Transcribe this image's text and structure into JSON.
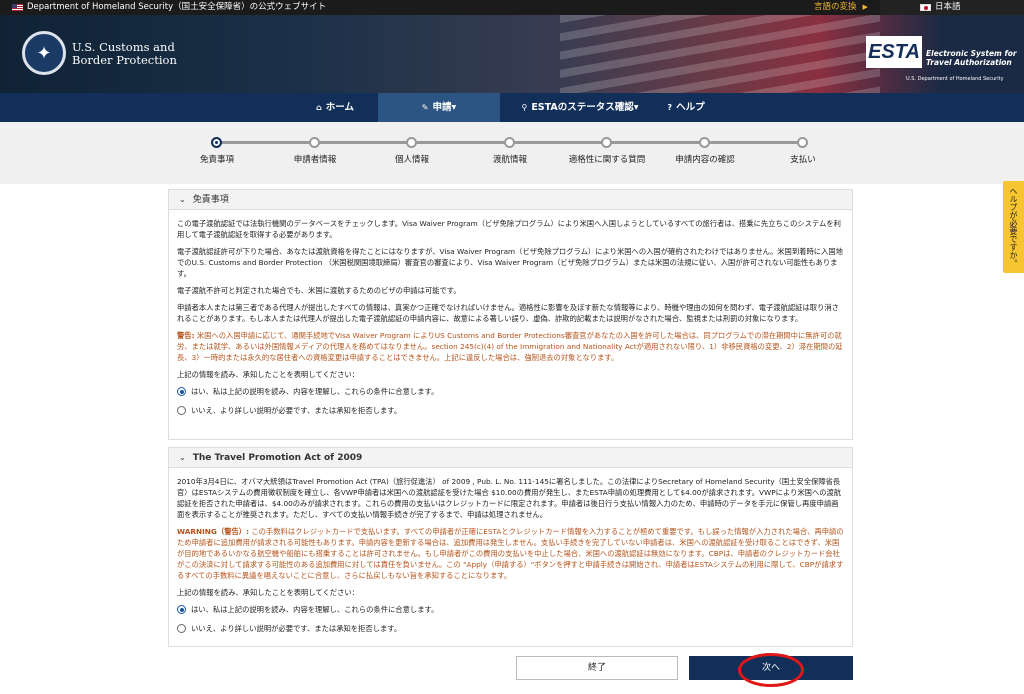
{
  "topbar": {
    "site_name": "Department of Homeland Security（国土安全保障省）の公式ウェブサイト",
    "language_change": "言語の変換",
    "language": "日本語"
  },
  "header": {
    "agency_line1": "U.S. Customs and",
    "agency_line2": "Border Protection",
    "esta_logo_text": "ESTA",
    "esta_tagline1": "Electronic System for",
    "esta_tagline2": "Travel Authorization",
    "esta_sub": "U.S. Department of Homeland Security"
  },
  "nav": {
    "home": "ホーム",
    "apply": "申請",
    "status": "ESTAのステータス確認",
    "help": "ヘルプ"
  },
  "steps": [
    {
      "label": "免責事項",
      "current": true
    },
    {
      "label": "申請者情報"
    },
    {
      "label": "個人情報"
    },
    {
      "label": "渡航情報"
    },
    {
      "label": "適格性に関する質問"
    },
    {
      "label": "申請内容の確認"
    },
    {
      "label": "支払い"
    }
  ],
  "disclaimer": {
    "title": "免責事項",
    "p1": "この電子渡航認証では法執行機関のデータベースをチェックします。Visa Waiver Program（ビザ免除プログラム）により米国へ入国しようとしているすべての旅行者は、搭乗に先立ちこのシステムを利用して電子渡航認証を取得する必要があります。",
    "p2": "電子渡航認証許可が下りた場合、あなたは渡航資格を得たことにはなりますが、Visa Waiver Program（ビザ免除プログラム）により米国への入国が確約されたわけではありません。米国到着時に入国地でのU.S. Customs and Border Protection （米国税関国境取締局）審査官の審査により、Visa Waiver Program（ビザ免除プログラム）または米国の法規に従い、入国が許可されない可能性もあります。",
    "p3": "電子渡航不許可と判定された場合でも、米国に渡航するためのビザの申請は可能です。",
    "p4": "申請者本人または第三者である代理人が提出したすべての情報は、真実かつ正確でなければいけません。適格性に影響を及ぼす新たな情報等により、時機や理由の如何を問わず、電子渡航認証は取り消されることがあります。もし本人または代理人が提出した電子渡航認証の申請内容に、故意による著しい誤り、虚偽、詐欺的記載または説明がなされた場合、監視または刑罰の対象になります。",
    "warn_label": "警告:",
    "warn_text": " 米国への入国申請に応じて、通関手続地でVisa Waiver Program によりUS Customs and Border Protections審査官があなたの入国を許可した場合は、同プログラムでの滞在期間中に無許可の就労、または就学、あるいは外国情報メディアの代理人を務めてはなりません。section 245(c)(4) of the Immigration and Nationality Actが適用されない限り、1）非移民資格の変更、2）滞在期間の延長、3）一時的または永久的な居住者への資格変更は申請することはできません。上記に違反した場合は、強制退去の対象となります。",
    "prompt": "上記の情報を読み、承知したことを表明してください：",
    "agree": "はい、私は上記の説明を読み、内容を理解し、これらの条件に合意します。",
    "disagree": "いいえ、より詳しい説明が必要です、または承知を拒否します。"
  },
  "tpa": {
    "title": "The Travel Promotion Act of 2009",
    "p1": "2010年3月4日に、オバマ大統領はTravel Promotion Act (TPA)（旅行促進法） of 2009 , Pub. L. No. 111-145に署名しました。この法律によりSecretary of Homeland Security（国土安全保障省長官）はESTAシステムの費用徴収制度を確立し、各VWP申請者は米国への渡航認証を受けた場合 $10.00の費用が発生し、またESTA申請の処理費用として$4.00が請求されます。VWPにより米国への渡航認証を拒否された申請者は、$4.00のみが請求されます。これらの費用の支払いはクレジットカードに限定されます。申請者は後日行う支払い情報入力のため、申請時のデータを手元に保管し再度申請画面を表示することが推奨されます。ただし、すべての支払い情報手続きが完了するまで、申請は処理されません。",
    "warn_label": "WARNING（警告）:",
    "warn_text": " この手数料はクレジットカードで支払います。すべての申請者が正確にESTAとクレジットカード情報を入力することが極めて重要です。もし誤った情報が入力された場合、再申請のため申請者に追加費用が請求される可能性もあります。申請内容を更新する場合は、追加費用は発生しません。支払い手続きを完了していない申請者は、米国への渡航認証を受け取ることはできず、米国が目的地であるいかなる航空機や船舶にも搭乗することは許可されません。もし申請者がこの費用の支払いを中止した場合、米国への渡航認証は無効になります。CBPは、申請者のクレジットカード会社がこの決済に対して請求する可能性のある追加費用に対しては責任を負いません。この \"Apply（申請する）\"ボタンを押すと申請手続きは開始され、申請者はESTAシステムの利用に際して、CBPが請求するすべての手数料に異議を唱えないことに合意し、さらに払戻しもない旨を承知することになります。",
    "prompt": "上記の情報を読み、承知したことを表明してください：",
    "agree": "はい、私は上記の説明を読み、内容を理解し、これらの条件に合意します。",
    "disagree": "いいえ、より詳しい説明が必要です、または承知を拒否します。"
  },
  "help_tab": "ヘルプが必要ですか。",
  "buttons": {
    "exit": "終了",
    "next": "次へ"
  }
}
